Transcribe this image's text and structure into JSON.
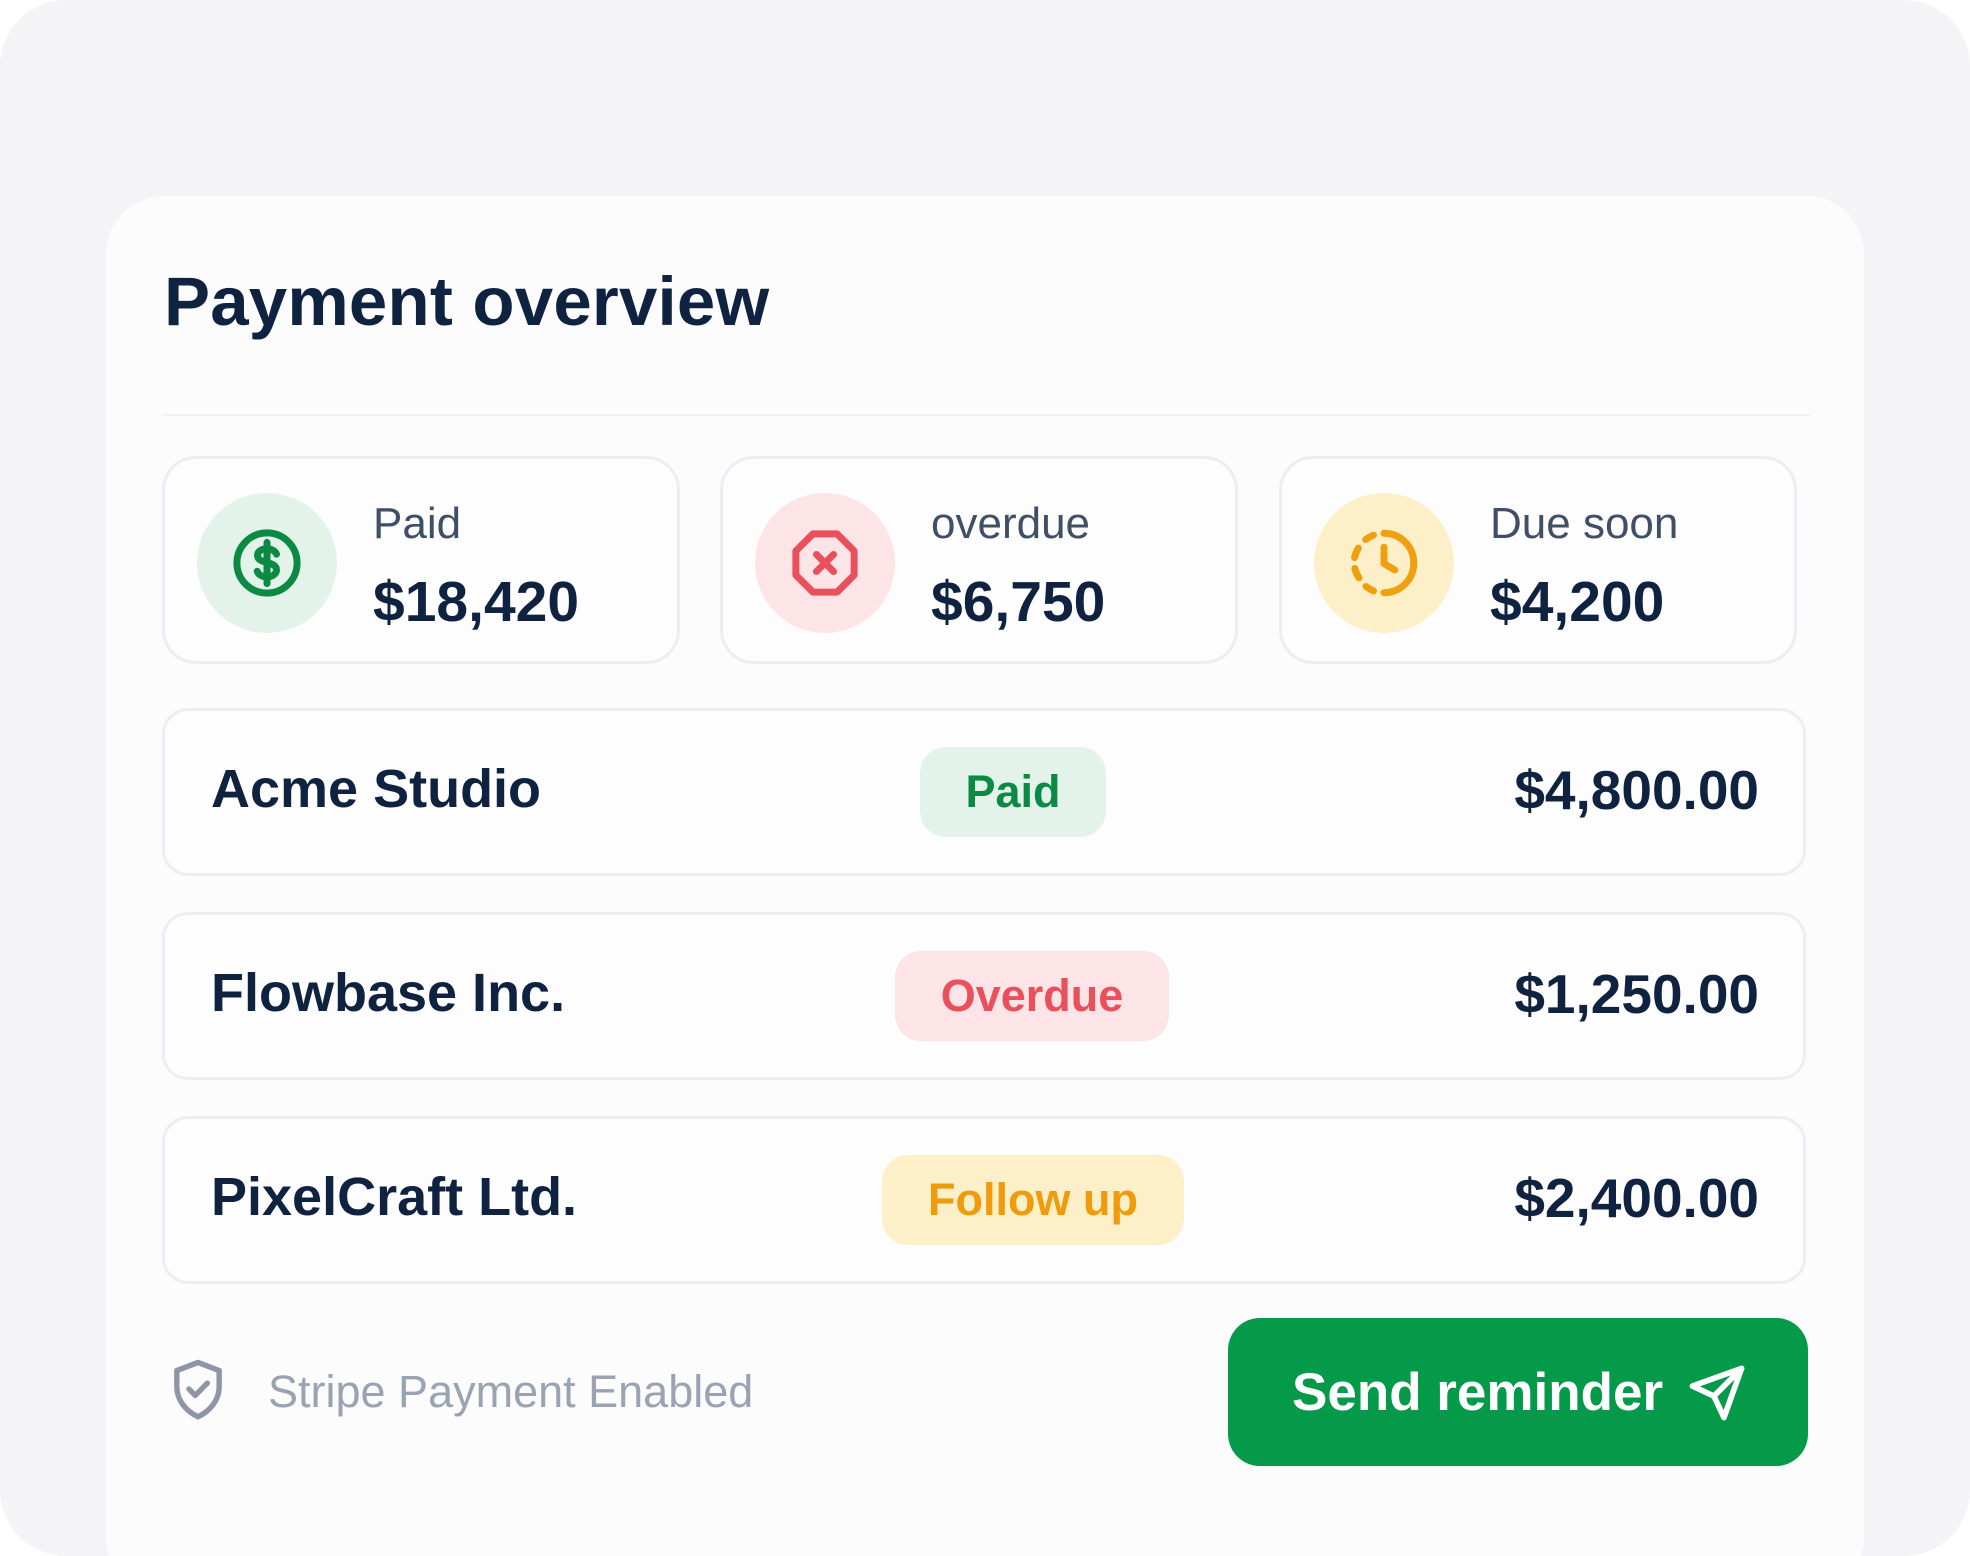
{
  "card": {
    "title": "Payment overview"
  },
  "summary": [
    {
      "label": "Paid",
      "value": "$18,420",
      "icon": "dollar-circle-icon",
      "icon_color": "#0b8a43",
      "bg_color": "#e3f3ea"
    },
    {
      "label": "overdue",
      "value": "$6,750",
      "icon": "x-octagon-icon",
      "icon_color": "#ea4f5c",
      "bg_color": "#fde4e6"
    },
    {
      "label": "Due soon",
      "value": "$4,200",
      "icon": "clock-dashed-icon",
      "icon_color": "#f0a00f",
      "bg_color": "#fdf0c8"
    }
  ],
  "payments": [
    {
      "client": "Acme Studio",
      "status": "Paid",
      "amount": "$4,800.00",
      "status_color": "#0b8a43",
      "status_bg": "#e3f3ea"
    },
    {
      "client": "Flowbase Inc.",
      "status": "Overdue",
      "amount": "$1,250.00",
      "status_color": "#ea4f5c",
      "status_bg": "#fde4e6"
    },
    {
      "client": "PixelCraft Ltd.",
      "status": "Follow up",
      "amount": "$2,400.00",
      "status_color": "#ef9b0b",
      "status_bg": "#fdf0c8"
    }
  ],
  "footer": {
    "note": "Stripe Payment Enabled",
    "note_icon": "shield-check-icon",
    "button_label": "Send reminder",
    "button_icon": "send-icon",
    "button_color": "#05994a"
  }
}
